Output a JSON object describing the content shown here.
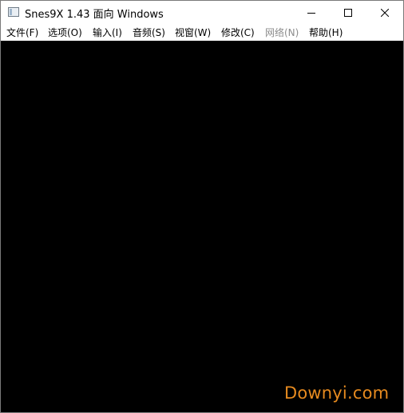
{
  "window": {
    "title": "Snes9X 1.43 面向 Windows"
  },
  "menu": {
    "items": [
      {
        "label": "文件(F)",
        "enabled": true
      },
      {
        "label": "选项(O)",
        "enabled": true
      },
      {
        "label": "输入(I)",
        "enabled": true
      },
      {
        "label": "音频(S)",
        "enabled": true
      },
      {
        "label": "视窗(W)",
        "enabled": true
      },
      {
        "label": "修改(C)",
        "enabled": true
      },
      {
        "label": "网络(N)",
        "enabled": false
      },
      {
        "label": "帮助(H)",
        "enabled": true
      }
    ]
  },
  "watermark": {
    "text": "Downyi.com",
    "color": "#e68a1f"
  },
  "colors": {
    "viewport_bg": "#000000",
    "disabled_text": "#8c8c8c"
  },
  "icons": {
    "app": "snes9x-window-icon",
    "minimize": "minimize-icon",
    "maximize": "maximize-icon",
    "close": "close-icon"
  }
}
